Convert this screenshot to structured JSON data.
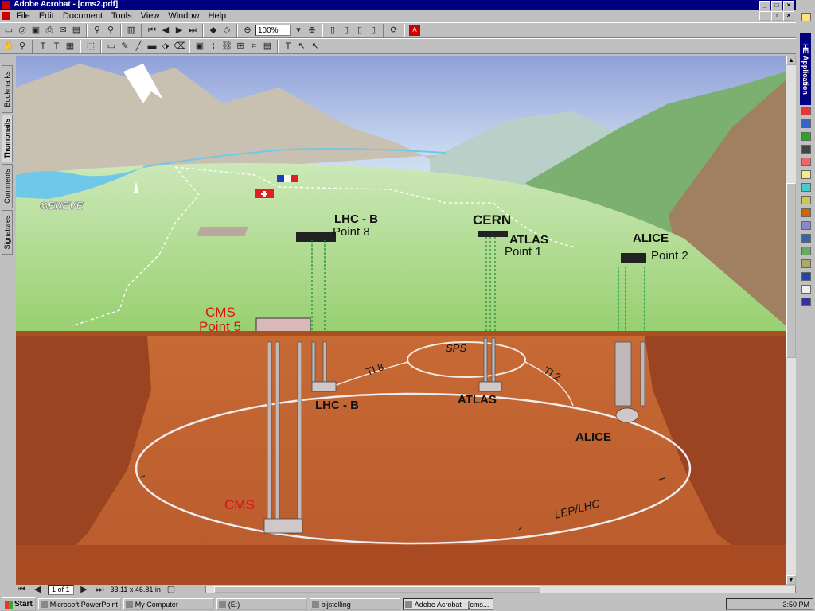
{
  "window": {
    "title": "Adobe Acrobat - [cms2.pdf]"
  },
  "menu": [
    "File",
    "Edit",
    "Document",
    "Tools",
    "View",
    "Window",
    "Help"
  ],
  "toolbar": {
    "zoom": "100%"
  },
  "nav_tabs": [
    "Bookmarks",
    "Thumbnails",
    "Comments",
    "Signatures"
  ],
  "status": {
    "page": "1 of 1",
    "size": "33.11 x 46.81 in"
  },
  "right_panel": {
    "title": "HE Application"
  },
  "document": {
    "city": "GENEVE",
    "lhcb_surface": "LHC - B",
    "point8": "Point 8",
    "cern": "CERN",
    "atlas_surface": "ATLAS",
    "point1": "Point 1",
    "alice_surface": "ALICE",
    "point2": "Point 2",
    "cms_surface": "CMS",
    "point5": "Point 5",
    "sps": "SPS",
    "ti8": "TI 8",
    "ti2": "TI 2",
    "lhcb_under": "LHC - B",
    "atlas_under": "ATLAS",
    "alice_under": "ALICE",
    "cms_under": "CMS",
    "ring": "LEP/LHC"
  },
  "taskbar": {
    "start": "Start",
    "tasks": [
      "Microsoft PowerPoint - [tal...",
      "My Computer",
      "(E:)",
      "bijstelling",
      "Adobe Acrobat - [cms..."
    ],
    "clock": "3:50 PM"
  },
  "colors": {
    "titlebar": "#000080",
    "cms_red": "#e01010",
    "earth": "#c8683a",
    "valley": "#a8d888"
  }
}
